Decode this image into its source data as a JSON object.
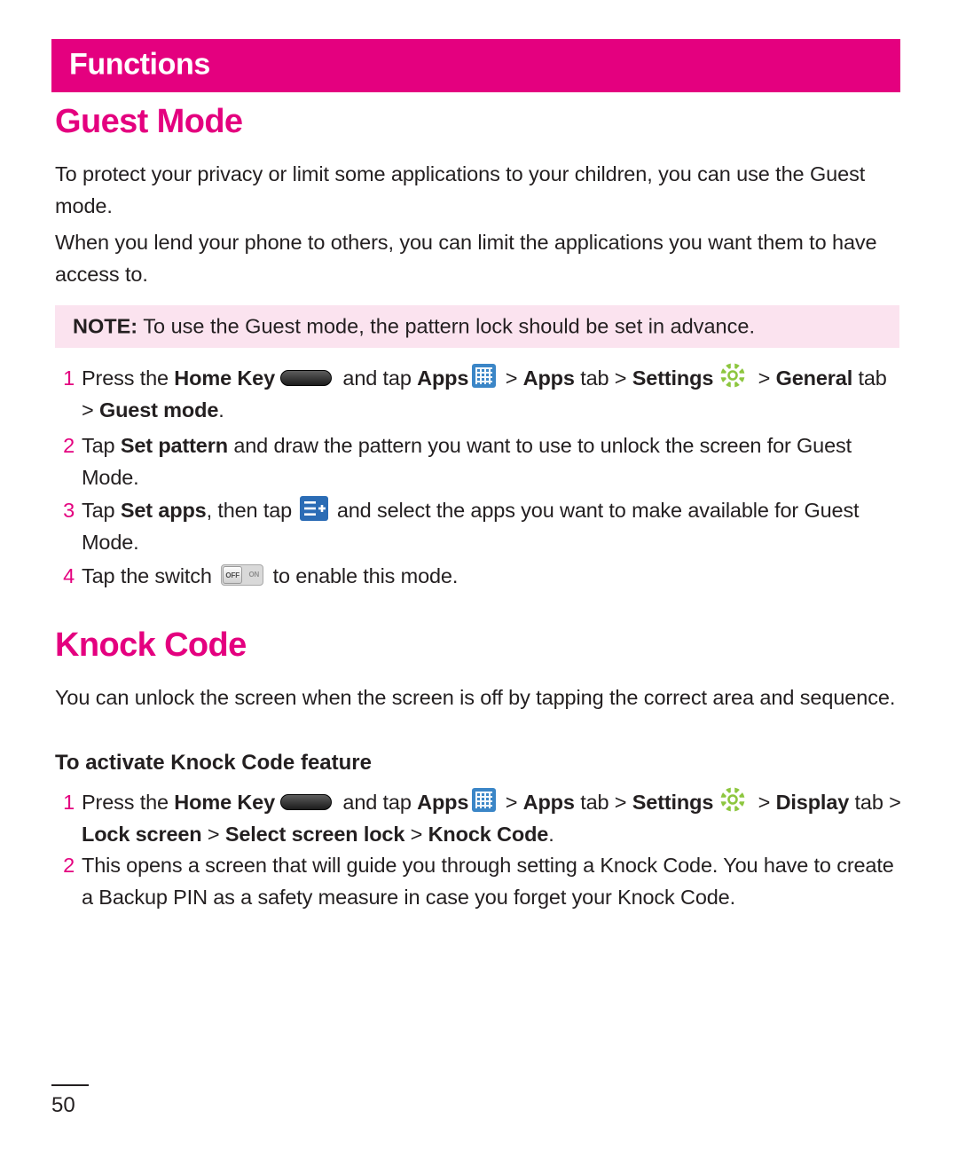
{
  "header": {
    "title": "Functions"
  },
  "sections": {
    "guest_mode": {
      "title": "Guest Mode",
      "para1": "To protect your privacy or limit some applications to your children, you can use the Guest mode.",
      "para2": "When you lend your phone to others, you can limit the applications you want them to have access to.",
      "note_label": "NOTE:",
      "note_text": " To use the Guest mode, the pattern lock should be set in advance.",
      "steps": [
        {
          "num": "1",
          "t1": "Press the ",
          "b1": "Home Key",
          "icon1": "home-key-icon",
          "t2": " and tap ",
          "b2": "Apps",
          "icon2": "apps-grid-icon",
          "t3": " > ",
          "b3": "Apps",
          "t4": " tab > ",
          "b4": "Settings",
          "icon3": "settings-gear-icon",
          "t5": " > ",
          "b5": "General",
          "t6": " tab > ",
          "b6": "Guest mode",
          "t7": "."
        },
        {
          "num": "2",
          "t1": "Tap ",
          "b1": "Set pattern",
          "t2": " and draw the pattern you want to use to unlock the screen for Guest Mode."
        },
        {
          "num": "3",
          "t1": "Tap ",
          "b1": "Set apps",
          "t2": ", then tap ",
          "icon1": "set-apps-icon",
          "t3": " and select the apps you want to make available for Guest Mode."
        },
        {
          "num": "4",
          "t1": "Tap the switch ",
          "icon1": "off-on-toggle-icon",
          "t2": " to enable this mode."
        }
      ]
    },
    "knock_code": {
      "title": "Knock Code",
      "para1": "You can unlock the screen when the screen is off by tapping the correct area and sequence.",
      "subhead": "To activate Knock Code feature",
      "steps": [
        {
          "num": "1",
          "t1": "Press the ",
          "b1": "Home Key",
          "icon1": "home-key-icon",
          "t2": " and tap ",
          "b2": "Apps",
          "icon2": "apps-grid-icon",
          "t3": " > ",
          "b3": "Apps",
          "t4": " tab > ",
          "b4": "Settings",
          "icon3": "settings-gear-icon",
          "t5": " > ",
          "b5": "Display",
          "t6": " tab > ",
          "b6": "Lock screen",
          "t7": " > ",
          "b7": "Select screen lock",
          "t8": " > ",
          "b8": "Knock Code",
          "t9": "."
        },
        {
          "num": "2",
          "t1": "This opens a screen that will guide you through setting a Knock Code. You have to create a Backup PIN as a safety measure in case you forget your Knock Code."
        }
      ]
    }
  },
  "footer": {
    "page_number": "50"
  },
  "colors": {
    "accent": "#e4007f",
    "note_bg": "#fbe3ef",
    "text": "#231f20"
  }
}
